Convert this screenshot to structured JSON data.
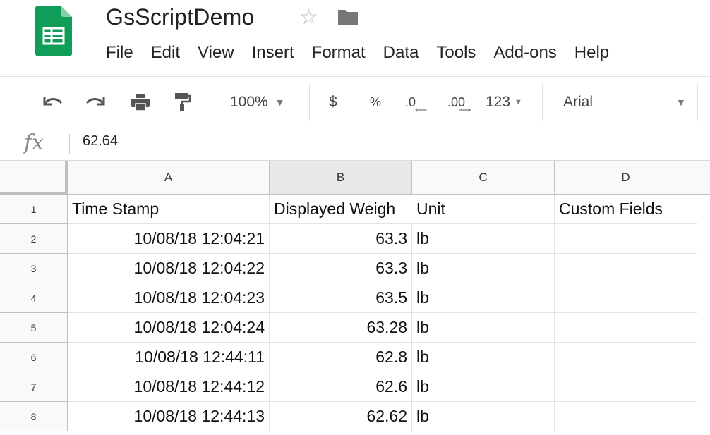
{
  "app": {
    "title": "GsScriptDemo",
    "brand_color": "#0f9d58"
  },
  "menu": [
    "File",
    "Edit",
    "View",
    "Insert",
    "Format",
    "Data",
    "Tools",
    "Add-ons",
    "Help"
  ],
  "toolbar": {
    "zoom": "100%",
    "currency": "$",
    "percent": "%",
    "decrease_decimals": ".0",
    "increase_decimals": ".00",
    "more_formats": "123",
    "font": "Arial"
  },
  "formula": {
    "fx_label": "fx",
    "value": "62.64"
  },
  "grid": {
    "columns": [
      "A",
      "B",
      "C",
      "D"
    ],
    "rows": [
      {
        "num": "1",
        "cells": [
          "Time Stamp",
          "Displayed Weigh",
          "Unit",
          "Custom Fields"
        ]
      },
      {
        "num": "2",
        "cells": [
          "10/08/18 12:04:21",
          "63.3",
          "lb",
          ""
        ]
      },
      {
        "num": "3",
        "cells": [
          "10/08/18 12:04:22",
          "63.3",
          "lb",
          ""
        ]
      },
      {
        "num": "4",
        "cells": [
          "10/08/18 12:04:23",
          "63.5",
          "lb",
          ""
        ]
      },
      {
        "num": "5",
        "cells": [
          "10/08/18 12:04:24",
          "63.28",
          "lb",
          ""
        ]
      },
      {
        "num": "6",
        "cells": [
          "10/08/18 12:44:11",
          "62.8",
          "lb",
          ""
        ]
      },
      {
        "num": "7",
        "cells": [
          "10/08/18 12:44:12",
          "62.6",
          "lb",
          ""
        ]
      },
      {
        "num": "8",
        "cells": [
          "10/08/18 12:44:13",
          "62.62",
          "lb",
          ""
        ]
      }
    ]
  }
}
